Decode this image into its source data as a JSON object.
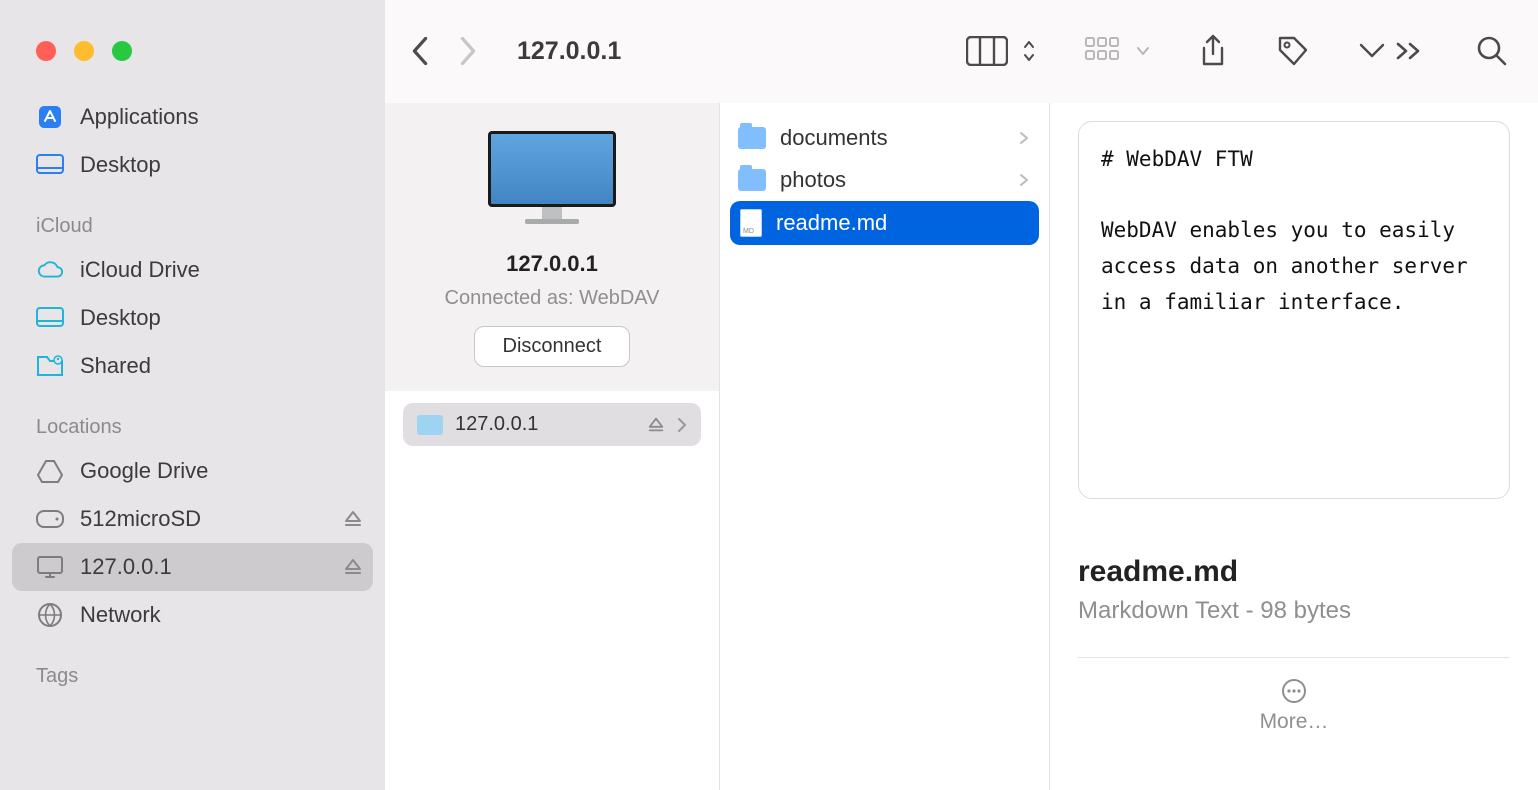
{
  "titlebar": {
    "title": "127.0.0.1"
  },
  "sidebar": {
    "favorites_top": [
      {
        "label": "Applications",
        "icon": "applications"
      },
      {
        "label": "Desktop",
        "icon": "desktop"
      }
    ],
    "icloud_header": "iCloud",
    "icloud": [
      {
        "label": "iCloud Drive",
        "icon": "cloud"
      },
      {
        "label": "Desktop",
        "icon": "desktop"
      },
      {
        "label": "Shared",
        "icon": "shared"
      }
    ],
    "locations_header": "Locations",
    "locations": [
      {
        "label": "Google Drive",
        "icon": "gdrive",
        "eject": false
      },
      {
        "label": "512microSD",
        "icon": "drive",
        "eject": true
      },
      {
        "label": "127.0.0.1",
        "icon": "monitor",
        "eject": true,
        "selected": true
      },
      {
        "label": "Network",
        "icon": "network",
        "eject": false
      }
    ],
    "tags_header": "Tags"
  },
  "server": {
    "name": "127.0.0.1",
    "status": "Connected as: WebDAV",
    "disconnect_label": "Disconnect",
    "row_label": "127.0.0.1"
  },
  "files": [
    {
      "label": "documents",
      "type": "folder"
    },
    {
      "label": "photos",
      "type": "folder"
    },
    {
      "label": "readme.md",
      "type": "file",
      "selected": true
    }
  ],
  "preview": {
    "content": "# WebDAV FTW\n\nWebDAV enables you to easily access data on another server in a familiar interface.",
    "filename": "readme.md",
    "meta": "Markdown Text - 98 bytes",
    "more_label": "More…"
  }
}
